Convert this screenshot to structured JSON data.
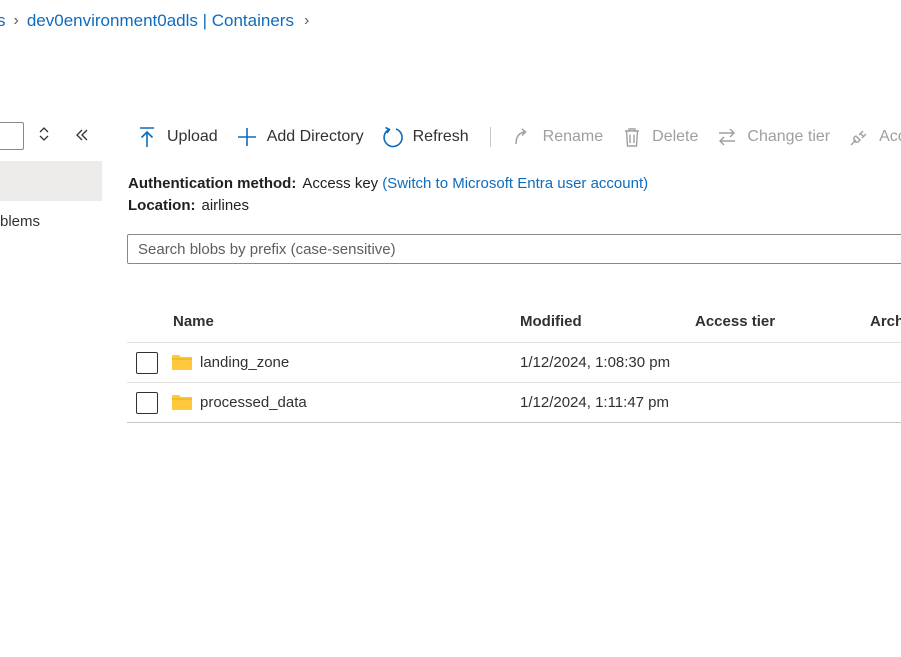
{
  "breadcrumb": {
    "prev_fragment": "s",
    "current": "dev0environment0adls | Containers"
  },
  "left_panel": {
    "nav_item_fragment": "blems"
  },
  "toolbar": {
    "upload": "Upload",
    "add_directory": "Add Directory",
    "refresh": "Refresh",
    "rename": "Rename",
    "delete": "Delete",
    "change_tier": "Change tier",
    "acquire_lease_fragment": "Acc"
  },
  "info": {
    "auth_label": "Authentication method:",
    "auth_value": "Access key",
    "auth_link": "(Switch to Microsoft Entra user account)",
    "location_label": "Location:",
    "location_value": "airlines"
  },
  "search": {
    "placeholder": "Search blobs by prefix (case-sensitive)"
  },
  "table": {
    "headers": {
      "name": "Name",
      "modified": "Modified",
      "access_tier": "Access tier",
      "archive_fragment": "Arch"
    },
    "rows": [
      {
        "name": "landing_zone",
        "modified": "1/12/2024, 1:08:30 pm",
        "type_icon": "folder-icon"
      },
      {
        "name": "processed_data",
        "modified": "1/12/2024, 1:11:47 pm",
        "type_icon": "folder-icon"
      }
    ]
  },
  "colors": {
    "accent": "#0f6cbd",
    "folder": "#ffc83d",
    "disabled": "#a19f9d"
  }
}
